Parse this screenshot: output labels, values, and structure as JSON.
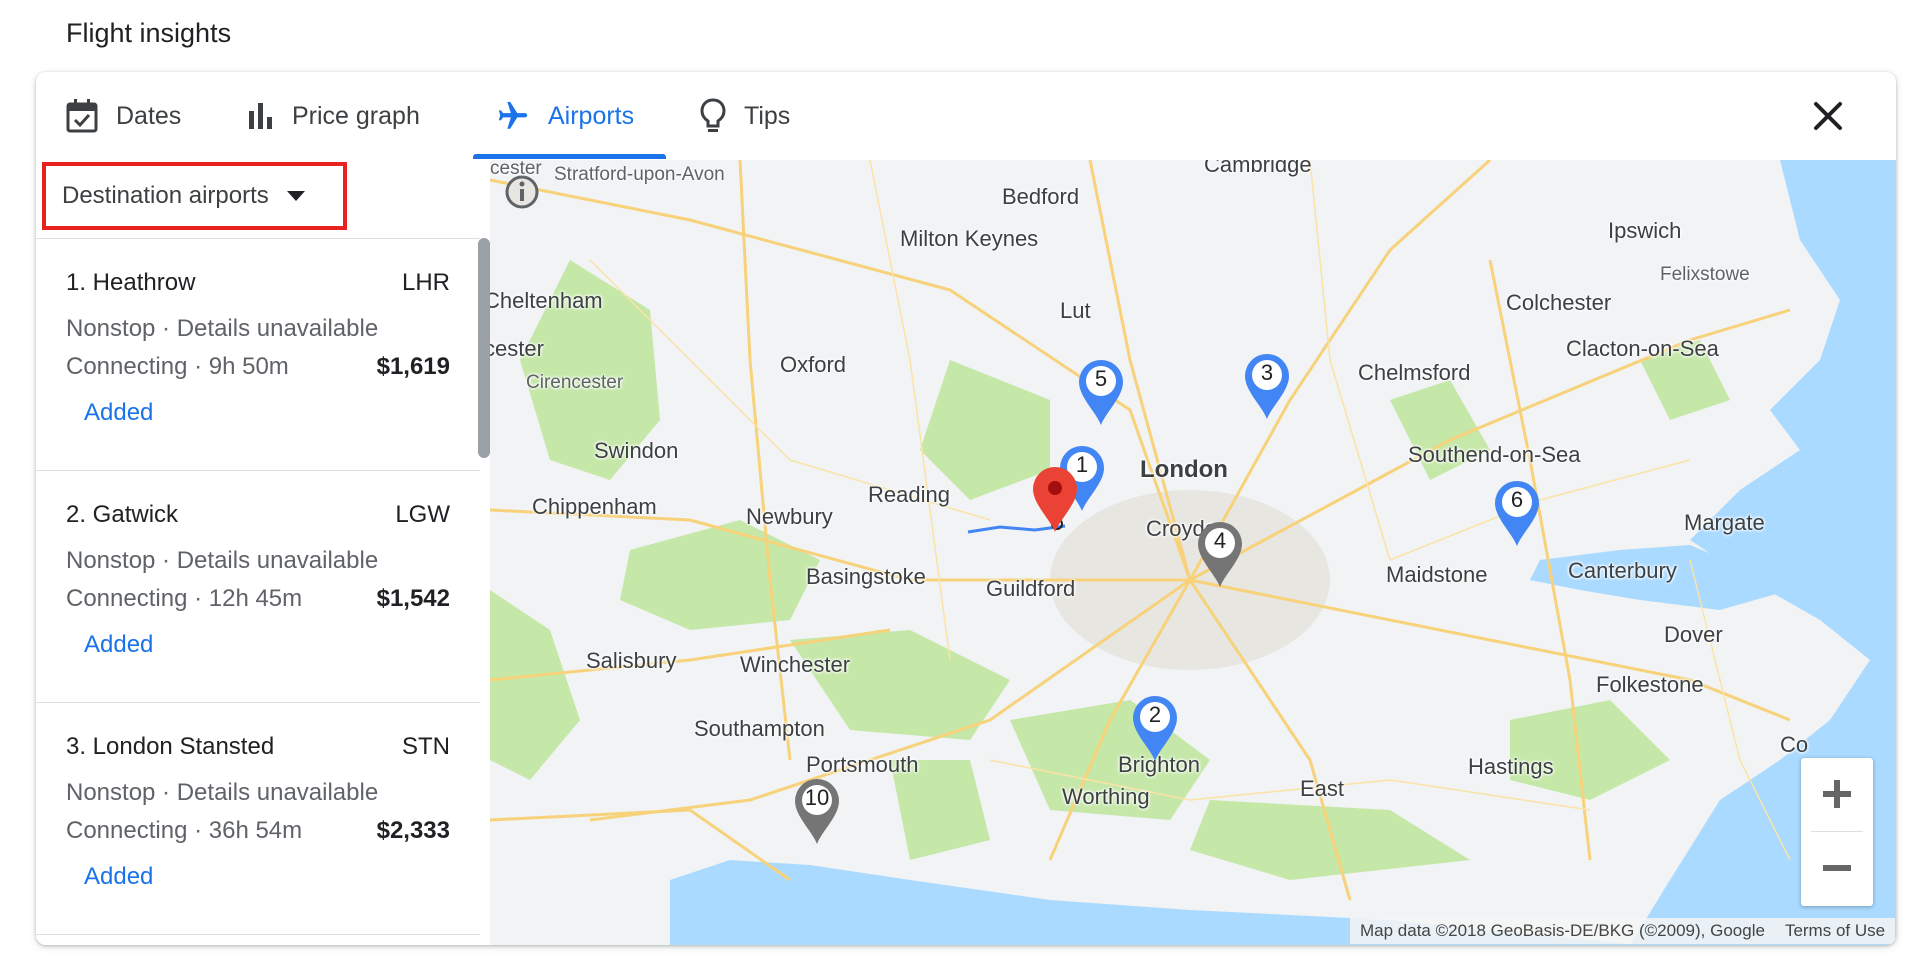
{
  "section_title": "Flight insights",
  "tabs": [
    {
      "label": "Dates",
      "icon": "calendar-check-icon"
    },
    {
      "label": "Price graph",
      "icon": "bar-chart-icon"
    },
    {
      "label": "Airports",
      "icon": "airplane-icon"
    },
    {
      "label": "Tips",
      "icon": "lightbulb-icon"
    }
  ],
  "active_tab": "Airports",
  "dropdown": {
    "label": "Destination airports"
  },
  "airports": [
    {
      "name": "1. Heathrow",
      "code": "LHR",
      "nonstop": "Nonstop · Details unavailable",
      "connecting": "Connecting · 9h 50m",
      "price": "$1,619",
      "status": "Added"
    },
    {
      "name": "2. Gatwick",
      "code": "LGW",
      "nonstop": "Nonstop · Details unavailable",
      "connecting": "Connecting · 12h 45m",
      "price": "$1,542",
      "status": "Added"
    },
    {
      "name": "3. London Stansted",
      "code": "STN",
      "nonstop": "Nonstop · Details unavailable",
      "connecting": "Connecting · 36h 54m",
      "price": "$2,333",
      "status": "Added"
    }
  ],
  "map": {
    "places": {
      "cambridge": "Cambridge",
      "stratford": "Stratford-upon-Avon",
      "bedford": "Bedford",
      "ipswich": "Ipswich",
      "milton_keynes": "Milton Keynes",
      "felixstowe": "Felixstowe",
      "cheltenham": "Cheltenham",
      "luton": "Lut",
      "colchester": "Colchester",
      "cester": "cester",
      "cester_top": "cester",
      "oxford": "Oxford",
      "clacton": "Clacton-on-Sea",
      "chelmsford": "Chelmsford",
      "cirencester": "Cirencester",
      "swindon": "Swindon",
      "london": "London",
      "southend": "Southend-on-Sea",
      "reading": "Reading",
      "chippenham": "Chippenham",
      "newbury": "Newbury",
      "croydon": "Croydon",
      "margate": "Margate",
      "basingstoke": "Basingstoke",
      "guildford": "Guildford",
      "maidstone": "Maidstone",
      "canterbury": "Canterbury",
      "salisbury": "Salisbury",
      "winchester": "Winchester",
      "dover": "Dover",
      "folkestone": "Folkestone",
      "southampton": "Southampton",
      "portsmouth": "Portsmouth",
      "brighton": "Brighton",
      "hastings": "Hastings",
      "east": "East",
      "worthing": "Worthing",
      "co": "Co"
    },
    "pins": [
      {
        "label": "1",
        "color": "#4285f4"
      },
      {
        "label": "2",
        "color": "#4285f4"
      },
      {
        "label": "3",
        "color": "#4285f4"
      },
      {
        "label": "4",
        "color": "#757575"
      },
      {
        "label": "5",
        "color": "#4285f4"
      },
      {
        "label": "6",
        "color": "#4285f4"
      },
      {
        "label": "10",
        "color": "#757575"
      }
    ],
    "destination_pin_color": "#ea4335",
    "attribution": "Map data ©2018 GeoBasis-DE/BKG (©2009), Google",
    "terms": "Terms of Use"
  },
  "colors": {
    "accent": "#1a73e8",
    "highlight_border": "#e8231e",
    "water": "#aadaff",
    "forest": "#c5e8a8"
  }
}
